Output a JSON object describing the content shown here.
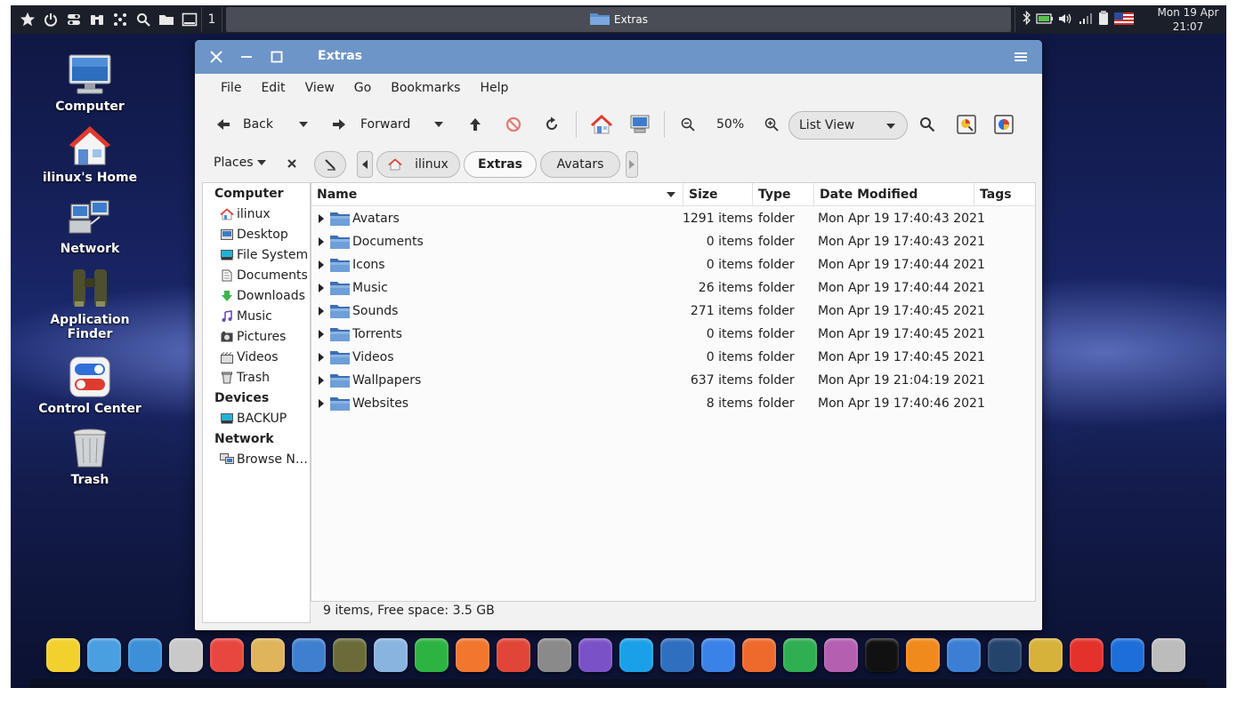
{
  "top_panel": {
    "workspace": "1",
    "task_title": "Extras",
    "clock_date": "Mon 19 Apr",
    "clock_time": "21:07"
  },
  "desktop_icons": [
    {
      "label": "Computer"
    },
    {
      "label": "ilinux's Home"
    },
    {
      "label": "Network"
    },
    {
      "label": "Application Finder"
    },
    {
      "label": "Control Center"
    },
    {
      "label": "Trash"
    }
  ],
  "window": {
    "title": "Extras",
    "menu": [
      "File",
      "Edit",
      "View",
      "Go",
      "Bookmarks",
      "Help"
    ],
    "toolbar": {
      "back": "Back",
      "forward": "Forward",
      "zoom": "50%",
      "view_mode": "List View"
    },
    "places_label": "Places",
    "breadcrumbs": [
      "ilinux",
      "Extras",
      "Avatars"
    ],
    "sidebar": {
      "sections": [
        {
          "title": "Computer",
          "items": [
            {
              "label": "ilinux",
              "icon": "home-icon"
            },
            {
              "label": "Desktop",
              "icon": "desktop-icon"
            },
            {
              "label": "File System",
              "icon": "filesystem-icon"
            },
            {
              "label": "Documents",
              "icon": "documents-icon"
            },
            {
              "label": "Downloads",
              "icon": "downloads-icon"
            },
            {
              "label": "Music",
              "icon": "music-icon"
            },
            {
              "label": "Pictures",
              "icon": "pictures-icon"
            },
            {
              "label": "Videos",
              "icon": "videos-icon"
            },
            {
              "label": "Trash",
              "icon": "trash-icon"
            }
          ]
        },
        {
          "title": "Devices",
          "items": [
            {
              "label": "BACKUP",
              "icon": "drive-icon"
            }
          ]
        },
        {
          "title": "Network",
          "items": [
            {
              "label": "Browse N…",
              "icon": "network-icon"
            }
          ]
        }
      ]
    },
    "columns": [
      "Name",
      "Size",
      "Type",
      "Date Modified",
      "Tags"
    ],
    "files": [
      {
        "name": "Avatars",
        "size": "1291 items",
        "type": "folder",
        "modified": "Mon Apr 19 17:40:43 2021"
      },
      {
        "name": "Documents",
        "size": "0 items",
        "type": "folder",
        "modified": "Mon Apr 19 17:40:43 2021"
      },
      {
        "name": "Icons",
        "size": "0 items",
        "type": "folder",
        "modified": "Mon Apr 19 17:40:44 2021"
      },
      {
        "name": "Music",
        "size": "26 items",
        "type": "folder",
        "modified": "Mon Apr 19 17:40:44 2021"
      },
      {
        "name": "Sounds",
        "size": "271 items",
        "type": "folder",
        "modified": "Mon Apr 19 17:40:45 2021"
      },
      {
        "name": "Torrents",
        "size": "0 items",
        "type": "folder",
        "modified": "Mon Apr 19 17:40:45 2021"
      },
      {
        "name": "Videos",
        "size": "0 items",
        "type": "folder",
        "modified": "Mon Apr 19 17:40:45 2021"
      },
      {
        "name": "Wallpapers",
        "size": "637 items",
        "type": "folder",
        "modified": "Mon Apr 19 21:04:19 2021"
      },
      {
        "name": "Websites",
        "size": "8 items",
        "type": "folder",
        "modified": "Mon Apr 19 17:40:46 2021"
      }
    ],
    "status": "9 items, Free space: 3.5 GB"
  },
  "dock": [
    {
      "icon": "star-icon",
      "color": "#f2d12e"
    },
    {
      "icon": "apps-dots-icon",
      "color": "#4a9fe0"
    },
    {
      "icon": "desktop-window-icon",
      "color": "#3d8fd8"
    },
    {
      "icon": "file-cabinet-icon",
      "color": "#c9c9c9"
    },
    {
      "icon": "control-center-icon",
      "color": "#e8473f"
    },
    {
      "icon": "palette-icon",
      "color": "#e0b45a"
    },
    {
      "icon": "store-icon",
      "color": "#3f7fd0"
    },
    {
      "icon": "binoculars-icon",
      "color": "#6b6b3a"
    },
    {
      "icon": "rocket-icon",
      "color": "#8ab4e0"
    },
    {
      "icon": "pipe-icon",
      "color": "#2db342"
    },
    {
      "icon": "firefox-icon",
      "color": "#f2762e"
    },
    {
      "icon": "chrome-icon",
      "color": "#e04537"
    },
    {
      "icon": "earth-pro-icon",
      "color": "#8a8a8a"
    },
    {
      "icon": "viber-icon",
      "color": "#7b51c8"
    },
    {
      "icon": "skype-icon",
      "color": "#1aa0e8"
    },
    {
      "icon": "mail-icon",
      "color": "#2f6fbf"
    },
    {
      "icon": "writer-icon",
      "color": "#3b82e8"
    },
    {
      "icon": "presentation-icon",
      "color": "#ee6a2c"
    },
    {
      "icon": "spreadsheet-icon",
      "color": "#2fae52"
    },
    {
      "icon": "webcam-icon",
      "color": "#b45fb0"
    },
    {
      "icon": "amazon-icon",
      "color": "#111111"
    },
    {
      "icon": "vlc-icon",
      "color": "#f08a1c"
    },
    {
      "icon": "qbittorrent-icon",
      "color": "#3b7fd4"
    },
    {
      "icon": "steam-icon",
      "color": "#25446c"
    },
    {
      "icon": "restore-icon",
      "color": "#d7b23a"
    },
    {
      "icon": "anydesk-icon",
      "color": "#e5312b"
    },
    {
      "icon": "teamviewer-icon",
      "color": "#1c6fd8"
    },
    {
      "icon": "trash-can-icon",
      "color": "#bcbcbc"
    }
  ]
}
